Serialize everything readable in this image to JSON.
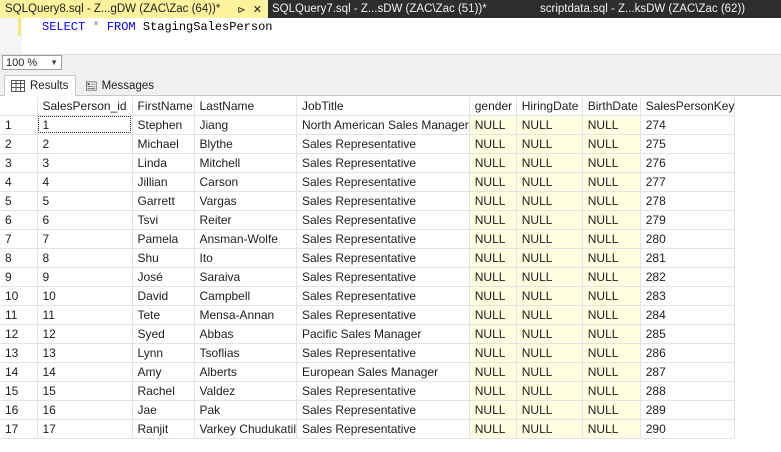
{
  "tabs": [
    {
      "label": "SQLQuery8.sql - Z...gDW (ZAC\\Zac (64))*",
      "active": true,
      "pin": "⊳",
      "close": "✕"
    },
    {
      "label": "SQLQuery7.sql - Z...sDW (ZAC\\Zac (51))*",
      "active": false
    },
    {
      "label": "scriptdata.sql - Z...ksDW (ZAC\\Zac (62))",
      "active": false
    }
  ],
  "editor": {
    "keyword_select": "SELECT",
    "star": "*",
    "keyword_from": "FROM",
    "table": "StagingSalesPerson"
  },
  "zoom": {
    "value": "100 %"
  },
  "result_tabs": {
    "results": "Results",
    "messages": "Messages"
  },
  "grid": {
    "columns": [
      "SalesPerson_id",
      "FirstName",
      "LastName",
      "JobTitle",
      "gender",
      "HiringDate",
      "BirthDate",
      "SalesPersonKey"
    ],
    "rows": [
      [
        "1",
        "1",
        "Stephen",
        "Jiang",
        "North American Sales Manager",
        "NULL",
        "NULL",
        "NULL",
        "274"
      ],
      [
        "2",
        "2",
        "Michael",
        "Blythe",
        "Sales Representative",
        "NULL",
        "NULL",
        "NULL",
        "275"
      ],
      [
        "3",
        "3",
        "Linda",
        "Mitchell",
        "Sales Representative",
        "NULL",
        "NULL",
        "NULL",
        "276"
      ],
      [
        "4",
        "4",
        "Jillian",
        "Carson",
        "Sales Representative",
        "NULL",
        "NULL",
        "NULL",
        "277"
      ],
      [
        "5",
        "5",
        "Garrett",
        "Vargas",
        "Sales Representative",
        "NULL",
        "NULL",
        "NULL",
        "278"
      ],
      [
        "6",
        "6",
        "Tsvi",
        "Reiter",
        "Sales Representative",
        "NULL",
        "NULL",
        "NULL",
        "279"
      ],
      [
        "7",
        "7",
        "Pamela",
        "Ansman-Wolfe",
        "Sales Representative",
        "NULL",
        "NULL",
        "NULL",
        "280"
      ],
      [
        "8",
        "8",
        "Shu",
        "Ito",
        "Sales Representative",
        "NULL",
        "NULL",
        "NULL",
        "281"
      ],
      [
        "9",
        "9",
        "José",
        "Saraiva",
        "Sales Representative",
        "NULL",
        "NULL",
        "NULL",
        "282"
      ],
      [
        "10",
        "10",
        "David",
        "Campbell",
        "Sales Representative",
        "NULL",
        "NULL",
        "NULL",
        "283"
      ],
      [
        "11",
        "11",
        "Tete",
        "Mensa-Annan",
        "Sales Representative",
        "NULL",
        "NULL",
        "NULL",
        "284"
      ],
      [
        "12",
        "12",
        "Syed",
        "Abbas",
        "Pacific Sales Manager",
        "NULL",
        "NULL",
        "NULL",
        "285"
      ],
      [
        "13",
        "13",
        "Lynn",
        "Tsoflias",
        "Sales Representative",
        "NULL",
        "NULL",
        "NULL",
        "286"
      ],
      [
        "14",
        "14",
        "Amy",
        "Alberts",
        "European Sales Manager",
        "NULL",
        "NULL",
        "NULL",
        "287"
      ],
      [
        "15",
        "15",
        "Rachel",
        "Valdez",
        "Sales Representative",
        "NULL",
        "NULL",
        "NULL",
        "288"
      ],
      [
        "16",
        "16",
        "Jae",
        "Pak",
        "Sales Representative",
        "NULL",
        "NULL",
        "NULL",
        "289"
      ],
      [
        "17",
        "17",
        "Ranjit",
        "Varkey Chudukatil",
        "Sales Representative",
        "NULL",
        "NULL",
        "NULL",
        "290"
      ]
    ]
  },
  "colors": {
    "active_tab": "#fff29d",
    "tabbar": "#2d2d30",
    "null_cell": "#fefee0",
    "keyword": "#0000ff"
  }
}
